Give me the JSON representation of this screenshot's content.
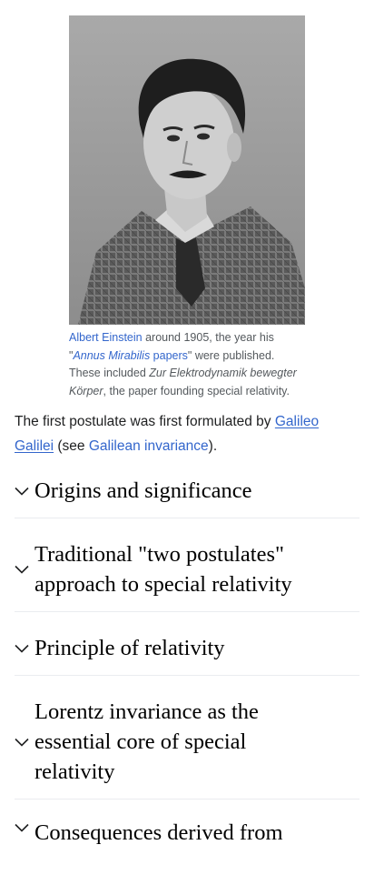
{
  "figure": {
    "image_name": "einstein-portrait-photo",
    "caption": {
      "link1": "Albert Einstein",
      "text1": " around 1905, the year his \"",
      "link2_italic": "Annus Mirabilis",
      "link2_rest": " papers",
      "text2": "\" were published. These included ",
      "italic_title": "Zur Elektrodynamik bewegter Körper",
      "text3": ", the paper founding special relativity."
    }
  },
  "paragraph": {
    "text1": "The first postulate was first formulated by ",
    "link_galileo": "Galileo Galilei",
    "text2": " (see ",
    "link_invariance": "Galilean invariance",
    "text3": ")."
  },
  "sections": [
    {
      "title": "Origins and significance"
    },
    {
      "title": "Traditional \"two postulates\" approach to special relativity"
    },
    {
      "title": "Principle of relativity"
    },
    {
      "title": "Lorentz invariance as the essential core of special relativity"
    },
    {
      "title": "Consequences derived from"
    }
  ],
  "colors": {
    "link": "#3366cc",
    "caption_text": "#54595d",
    "body_text": "#202122",
    "divider": "#eaecf0"
  }
}
